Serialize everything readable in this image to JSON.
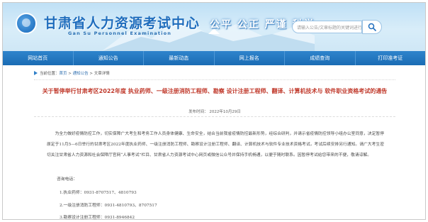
{
  "header": {
    "title": "甘肃省人力资源考试中心",
    "subtitle": "Gan Su Personnel Examination",
    "slogan": "公平 公正 严谨 科学",
    "search_placeholder": "请输入公告/文章标题的关键词进行搜索",
    "brand_color": "#1f6dbd"
  },
  "nav": {
    "items": [
      "网站首页",
      "通知公告",
      "最新动态",
      "网上报名",
      "成绩查询",
      "打印准考证"
    ]
  },
  "breadcrumb": {
    "prefix": "当前位置：",
    "home": "首页",
    "sep": " > ",
    "section": "通知公告",
    "current": "文章详情"
  },
  "article": {
    "title": "关于暂停举行甘肃考区2022年度 执业药师、一级注册消防工程师、勘察 设计注册工程师、翻译、计算机技术与 软件职业资格考试的通告",
    "pubdate": "发布时间： 2022年10月29日",
    "body": "为全力做好疫情防控工作，切实保障广大考生和考务工作人员身体健康、生命安全，结合当前我省疫情防控最新形势，经综合研判，并请示省疫情防控领导小组办公室同意，决定暂停原定于11月5—6日举行的甘肃考区2022年度执业药师、一级注册消防工程师、勘察设计注册工程师、翻译、计算机技术与软件专业技术资格考试，考试后续安排另行通知。请广大考生密切关注甘肃省人力资源和社会保障厅官网“人事考试”栏目、甘肃省人力资源考试中心网页或微信公众号并保持手机畅通，以便于随时联系。因暂停考试给您带来的不便，敬请谅解。",
    "contact_heading": "咨询电话：",
    "contacts": [
      "1.执业药师：0931-8707517、4810793",
      "2.一级注册消防工程师：0931-4810793、8707517",
      "3.勘察设计注册工程师：0931-8946842"
    ]
  }
}
